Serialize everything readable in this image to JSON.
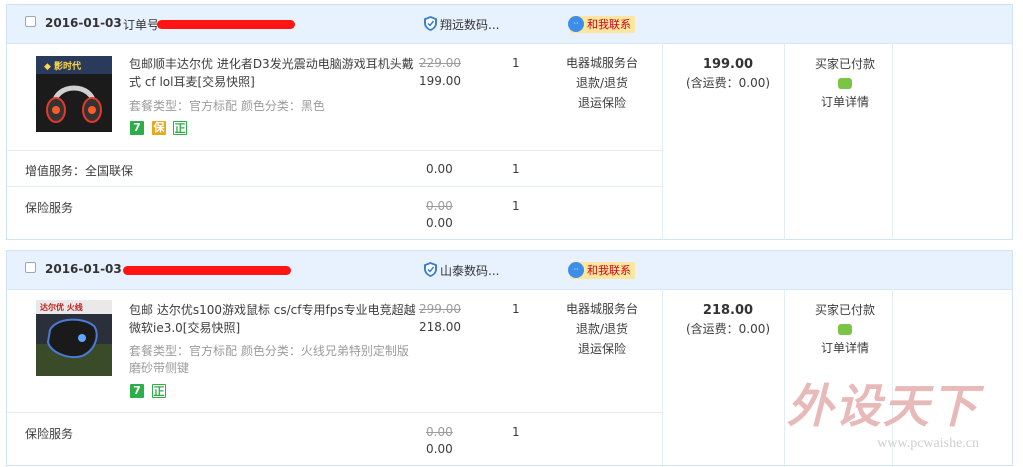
{
  "orders": [
    {
      "date": "2016-01-03",
      "shop": "翔远数码...",
      "contact": "和我联系",
      "item": {
        "title": "包邮顺丰达尔优 进化者D3发光震动电脑游戏耳机头戴式 cf lol耳麦[交易快照]",
        "spec": "套餐类型：官方标配 颜色分类：黑色",
        "price_old": "229.00",
        "price": "199.00",
        "qty": "1",
        "badges": [
          "7",
          "保",
          "正"
        ]
      },
      "service": [
        "电器城服务台",
        "退款/退货",
        "退运保险"
      ],
      "total": "199.00",
      "shipping": "(含运费：0.00)",
      "status": "买家已付款",
      "detail": "订单详情",
      "extras": [
        {
          "label": "增值服务：全国联保",
          "price": "0.00",
          "qty": "1"
        },
        {
          "label": "保险服务",
          "price_old": "0.00",
          "price": "0.00",
          "qty": "1"
        }
      ]
    },
    {
      "date": "2016-01-03",
      "shop": "山泰数码...",
      "contact": "和我联系",
      "item": {
        "title": "包邮 达尔优s100游戏鼠标 cs/cf专用fps专业电竞超越微软ie3.0[交易快照]",
        "spec": "套餐类型：官方标配 颜色分类：火线兄弟特别定制版磨砂带侧键",
        "price_old": "299.00",
        "price": "218.00",
        "qty": "1",
        "badges": [
          "7",
          "正"
        ]
      },
      "service": [
        "电器城服务台",
        "退款/退货",
        "退运保险"
      ],
      "total": "218.00",
      "shipping": "(含运费：0.00)",
      "status": "买家已付款",
      "detail": "订单详情",
      "extras": [
        {
          "label": "保险服务",
          "price_old": "0.00",
          "price": "0.00",
          "qty": "1"
        }
      ]
    }
  ],
  "watermark": {
    "big": "外设天下",
    "small": "www.pcwaishe.cn"
  },
  "colors": {
    "header_bg": "#e8f2ff",
    "border": "#cfe4f3",
    "contact_bg": "#fde69d",
    "redact": "#ff1414"
  }
}
